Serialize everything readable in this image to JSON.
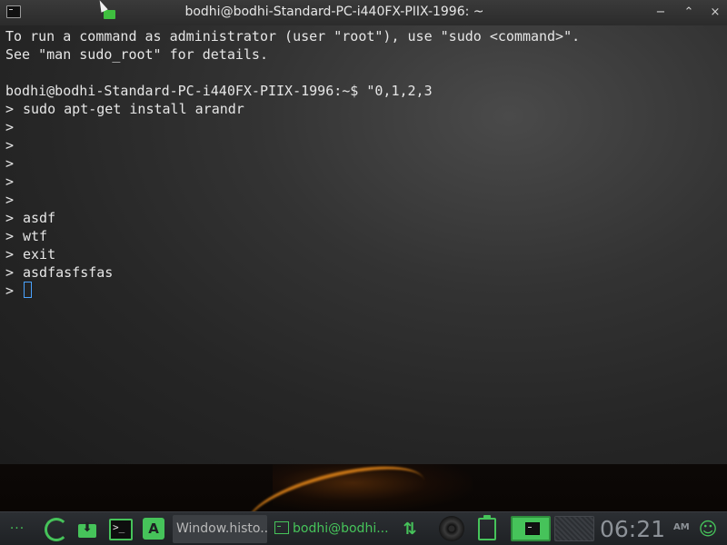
{
  "window": {
    "title": "bodhi@bodhi-Standard-PC-i440FX-PIIX-1996: ~",
    "minimize_glyph": "−",
    "restore_glyph": "⌃",
    "close_glyph": "×"
  },
  "terminal": {
    "lines": [
      "To run a command as administrator (user \"root\"), use \"sudo <command>\".",
      "See \"man sudo_root\" for details.",
      "",
      "bodhi@bodhi-Standard-PC-i440FX-PIIX-1996:~$ \"0,1,2,3",
      "sudo apt-get install arandr",
      "",
      "",
      "",
      "",
      "",
      "asdf",
      "wtf",
      "exit",
      "asdfasfsfas",
      ""
    ],
    "continuation_prompt": ">"
  },
  "taskbar": {
    "menu_dots": "···",
    "download_arrow": "⬇",
    "terminal_glyph": ">_",
    "apps_glyph": "A",
    "tasks": [
      {
        "label": "Window.histo..."
      },
      {
        "label": "bodhi@bodhi..."
      }
    ],
    "network_glyph": "⇅",
    "clock": {
      "time": "06:21",
      "ampm": "AM"
    },
    "user_glyph": "☺"
  },
  "icons": {
    "window_icon": "terminal-icon",
    "network": "network-arrows-icon",
    "disc": "media-disc-icon",
    "clipboard": "clipboard-icon"
  },
  "colors": {
    "accent": "#46c35a",
    "terminal_text": "#e6e6e6",
    "cursor": "#4aa3ff"
  }
}
